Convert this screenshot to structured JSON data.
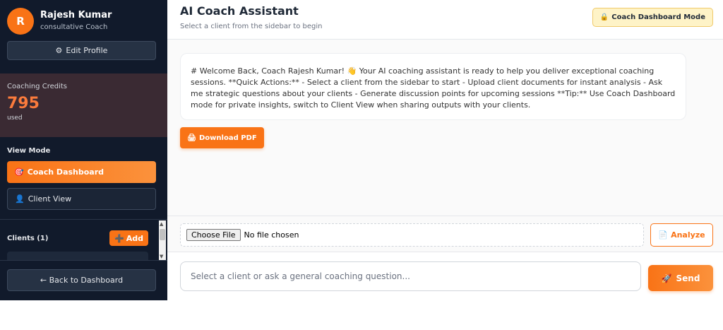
{
  "sidebar": {
    "avatar_initial": "R",
    "user_name": "Rajesh Kumar",
    "user_role": "consultative Coach",
    "edit_profile_label": "Edit Profile",
    "credits": {
      "label": "Coaching Credits",
      "value": "795",
      "sub": "used"
    },
    "view_mode": {
      "label": "View Mode",
      "coach_dashboard_label": "Coach Dashboard",
      "client_view_label": "Client View"
    },
    "clients": {
      "label": "Clients (1)",
      "add_label": "Add"
    },
    "back_label": "← Back to Dashboard"
  },
  "header": {
    "title": "AI Coach Assistant",
    "subtitle": "Select a client from the sidebar to begin",
    "mode_badge": "Coach Dashboard Mode"
  },
  "chat": {
    "welcome_message": "# Welcome Back, Coach Rajesh Kumar! 👋 Your AI coaching assistant is ready to help you deliver exceptional coaching sessions. **Quick Actions:** - Select a client from the sidebar to start - Upload client documents for instant analysis - Ask me strategic questions about your clients - Generate discussion points for upcoming sessions **Tip:** Use Coach Dashboard mode for private insights, switch to Client View when sharing outputs with your clients.",
    "download_label": "Download PDF"
  },
  "upload": {
    "choose_file_label": "Choose File",
    "no_file_text": "No file chosen",
    "analyze_label": "Analyze"
  },
  "input": {
    "placeholder": "Select a client or ask a general coaching question...",
    "send_label": "Send"
  },
  "colors": {
    "accent": "#f97316",
    "sidebar_bg": "#111a2b",
    "credits_bg": "#3a2a33",
    "badge_bg": "#fef3c7"
  }
}
